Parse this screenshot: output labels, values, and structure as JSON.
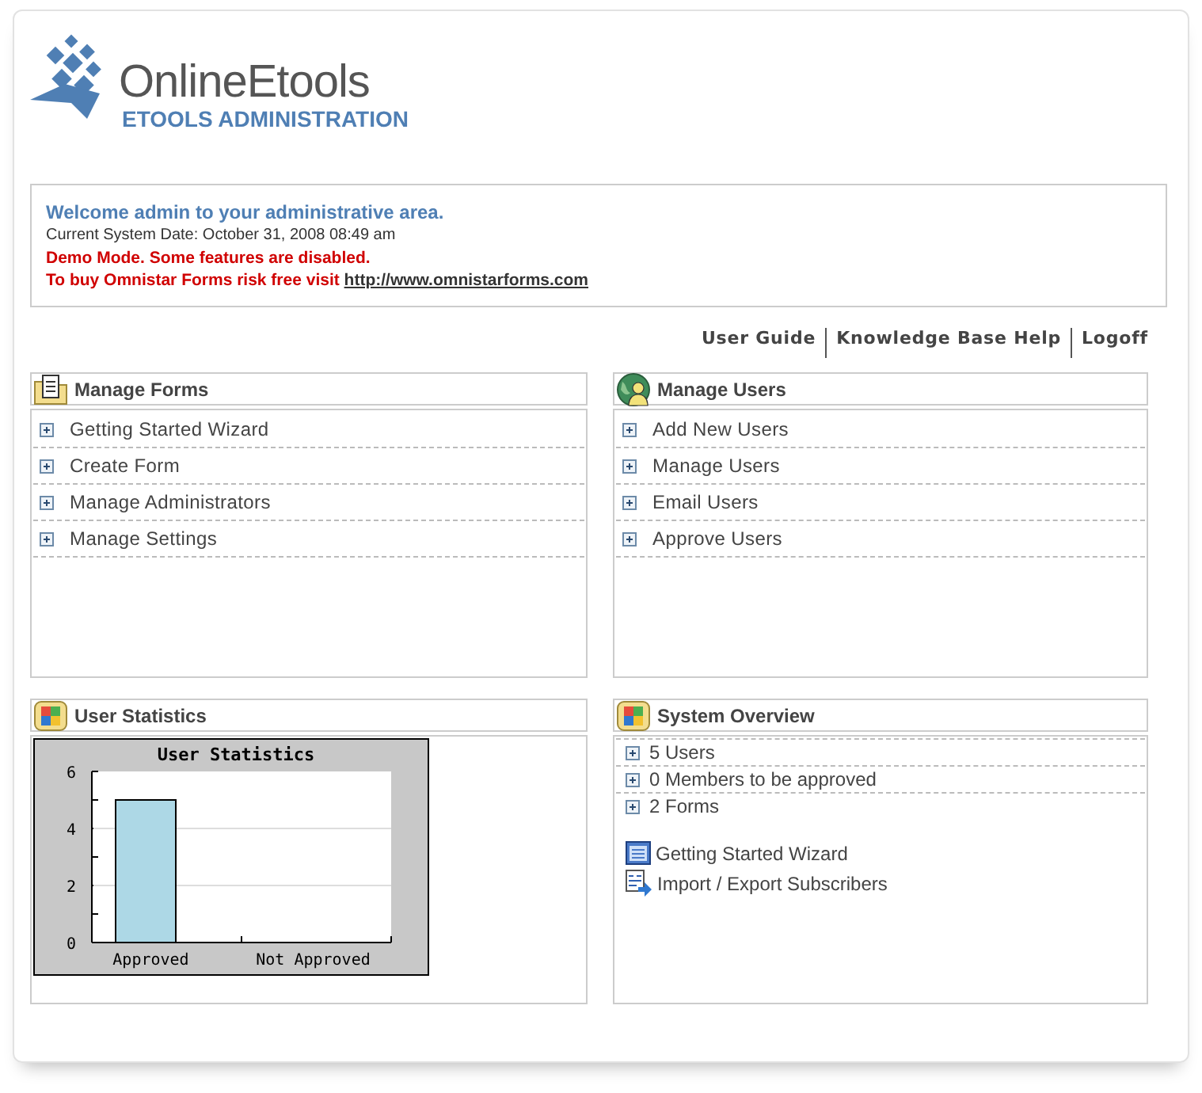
{
  "logo": {
    "name": "OnlineEtools",
    "subtitle": "ETOOLS ADMINISTRATION"
  },
  "notice": {
    "welcome": "Welcome admin to your administrative area.",
    "date": "Current System Date: October 31, 2008 08:49 am",
    "demo": "Demo Mode. Some features are disabled.",
    "buy_text": "To buy Omnistar Forms risk free visit",
    "buy_link": "http://www.omnistarforms.com"
  },
  "top_links": [
    "User Guide",
    "Knowledge Base Help",
    "Logoff"
  ],
  "panels": [
    {
      "kind": "links",
      "title": "Manage Forms",
      "items": [
        "Getting Started Wizard",
        "Create Form",
        "Manage Administrators",
        "Manage Settings"
      ]
    },
    {
      "kind": "links",
      "title": "Manage Users",
      "items": [
        "Add New Users",
        "Manage Users",
        "Email Users",
        "Approve Users"
      ]
    },
    {
      "kind": "chart",
      "title": "User Statistics",
      "chart_data": {
        "type": "bar",
        "title": "User Statistics",
        "categories": [
          "Approved",
          "Not Approved"
        ],
        "values": [
          5,
          0
        ],
        "ylim": [
          0,
          6
        ],
        "yticks": [
          0,
          2,
          4,
          6
        ]
      }
    },
    {
      "kind": "overview",
      "title": "System Overview",
      "stats": [
        "5 Users",
        "0 Members to be approved",
        "2 Forms"
      ],
      "shortcuts": [
        {
          "label": "Getting Started Wizard"
        },
        {
          "label": "Import / Export Subscribers"
        }
      ]
    }
  ]
}
